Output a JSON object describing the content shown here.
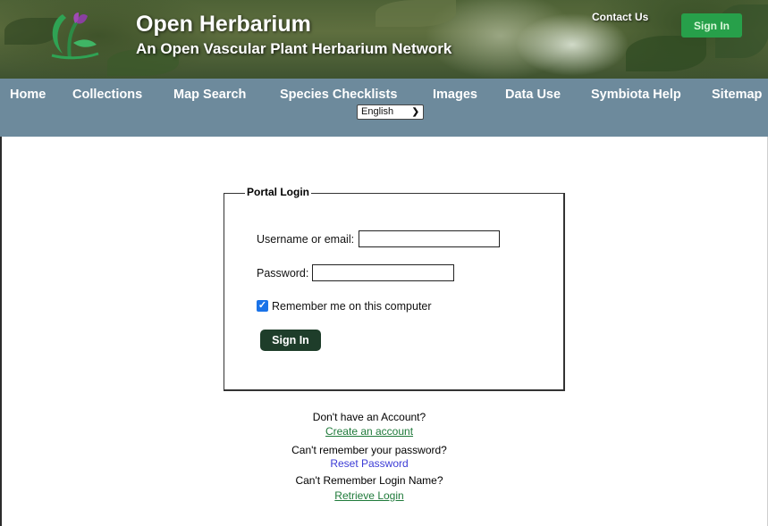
{
  "header": {
    "title": "Open Herbarium",
    "subtitle": "An Open Vascular Plant Herbarium Network",
    "contact_label": "Contact Us",
    "signin_label": "Sign In",
    "logo_icon": "plant-logo-icon"
  },
  "nav": {
    "items": [
      {
        "label": "Home"
      },
      {
        "label": "Collections"
      },
      {
        "label": "Map Search"
      },
      {
        "label": "Species Checklists"
      },
      {
        "label": "Images"
      },
      {
        "label": "Data Use"
      },
      {
        "label": "Symbiota Help"
      },
      {
        "label": "Sitemap"
      }
    ],
    "language": {
      "selected": "English",
      "chevron_icon": "chevron-down-icon"
    }
  },
  "login": {
    "legend": "Portal Login",
    "username_label": "Username or email:",
    "username_value": "",
    "password_label": "Password:",
    "password_value": "",
    "remember_label": "Remember me on this computer",
    "remember_checked": true,
    "submit_label": "Sign In"
  },
  "help": {
    "no_account_text": "Don't have an Account?",
    "create_account_link": "Create an account",
    "forgot_password_text": "Can't remember your password?",
    "reset_password_link": "Reset Password",
    "forgot_login_text": "Can't Remember Login Name?",
    "retrieve_login_link": "Retrieve Login"
  },
  "colors": {
    "nav_background": "#6d8a9c",
    "header_signin_button": "#27a04a",
    "form_signin_button": "#1e3d2a",
    "green_link": "#1f7a3a",
    "blue_link": "#3b3bd6",
    "checkbox_accent": "#1a73e8"
  }
}
